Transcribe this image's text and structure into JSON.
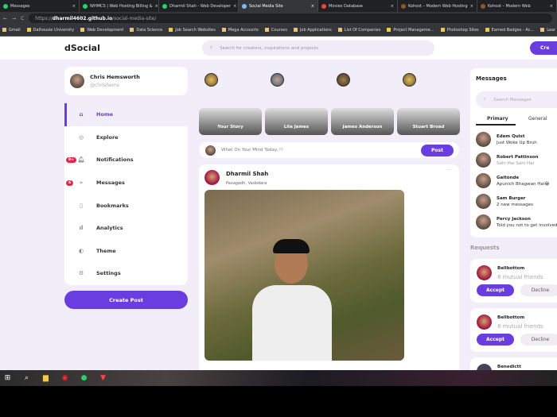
{
  "browser": {
    "tabs": [
      {
        "title": "Messages",
        "active": false
      },
      {
        "title": "WHMCS | Web Hosting Billing &",
        "active": false
      },
      {
        "title": "Dharmil Shah - Web Developer",
        "active": false
      },
      {
        "title": "Social Media Site",
        "active": true
      },
      {
        "title": "Movies Database",
        "active": false
      },
      {
        "title": "Kohost – Modern Web Hosting",
        "active": false
      },
      {
        "title": "Kohost – Modern Web",
        "active": false
      }
    ],
    "url_domain": "dharmil4602.github.io",
    "url_prefix": "https://",
    "url_path": "/social-media-site/",
    "bookmarks": [
      "Gmail",
      "Dalhousie University",
      "Web Development",
      "Data Science",
      "Job Search Websites",
      "Mega Accounts",
      "Courses",
      "Job Applications",
      "List Of Companies",
      "Project Manageme...",
      "Photoshop Sites",
      "Earned Badges - Ac...",
      "Lear"
    ]
  },
  "header": {
    "logo": "dSocial",
    "search_placeholder": "Search for creators, inspirations and projects",
    "create_label": "Cre"
  },
  "profile": {
    "name": "Chris Hemsworth",
    "handle": "@chrishems"
  },
  "menu": [
    {
      "label": "Home",
      "icon": "⌂",
      "active": true
    },
    {
      "label": "Explore",
      "icon": "◎"
    },
    {
      "label": "Notifications",
      "icon": "🔔︎",
      "badge": "9+"
    },
    {
      "label": "Messages",
      "icon": "➢",
      "badge": "6"
    },
    {
      "label": "Bookmarks",
      "icon": "▯"
    },
    {
      "label": "Analytics",
      "icon": "ıl"
    },
    {
      "label": "Theme",
      "icon": "◐"
    },
    {
      "label": "Settings",
      "icon": "⚙"
    }
  ],
  "create_post": "Create Post",
  "stories": [
    "Your Story",
    "Lila James",
    "James Anderson",
    "Stuart Broad"
  ],
  "compose": {
    "placeholder": "What On Your Mind Today. !!",
    "post_label": "Post"
  },
  "feed": {
    "name": "Dharmil Shah",
    "location": "Pavagadh, Vadodara",
    "more": "···"
  },
  "messages": {
    "title": "Messages",
    "search_placeholder": "Search Messages",
    "tabs": [
      "Primary",
      "General"
    ],
    "items": [
      {
        "name": "Edem Quist",
        "text": "Just Woke Up Bruh"
      },
      {
        "name": "Robert Pattinson",
        "text": "Sahi Hai Sahi Hai"
      },
      {
        "name": "Gaitonde",
        "text": "Apunich Bhagwan Hai😂"
      },
      {
        "name": "Sam Burger",
        "text": "2 new messages"
      },
      {
        "name": "Percy Jackson",
        "text": "Told you not to get involved"
      }
    ]
  },
  "requests": {
    "title": "Requests",
    "accept": "Accept",
    "decline": "Decline",
    "items": [
      {
        "name": "Bellbottom",
        "mutual": "8 mutual friends"
      },
      {
        "name": "Bellbottom",
        "mutual": "8 mutual friends"
      },
      {
        "name": "Benedictt",
        "mutual": ""
      }
    ]
  }
}
